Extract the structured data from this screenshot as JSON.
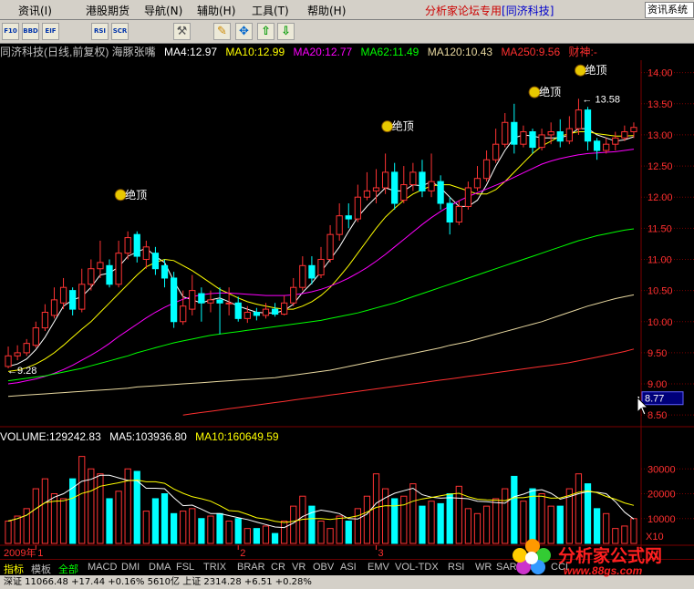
{
  "menu": {
    "items": [
      "资讯(I)",
      "港股期货",
      "导航(N)",
      "辅助(H)",
      "工具(T)",
      "帮助(H)"
    ],
    "brand": "分析家论坛专用",
    "brand_app": "[同济科技]",
    "right_label": "资讯系统"
  },
  "toolbar": {
    "buttons": [
      "F10",
      "BBD",
      "EIF",
      "RSI",
      "SCR",
      "tools-icon",
      "pencil-icon",
      "move-icon",
      "arrow-up-icon",
      "arrow-down-icon"
    ]
  },
  "info": {
    "title": "同济科技(日线,前复权) 海豚张嘴",
    "ma": [
      {
        "label": "MA4:12.97",
        "color": "#ffffff"
      },
      {
        "label": "MA10:12.99",
        "color": "#ffff00"
      },
      {
        "label": "MA20:12.77",
        "color": "#ff00ff"
      },
      {
        "label": "MA62:11.49",
        "color": "#00ff00"
      },
      {
        "label": "MA120:10.43",
        "color": "#e8d8a0"
      },
      {
        "label": "MA250:9.56",
        "color": "#ff3030"
      }
    ],
    "extra": "财神:-"
  },
  "volume_info": {
    "items": [
      {
        "label": "VOLUME:129242.83",
        "color": "#ffffff"
      },
      {
        "label": "MA5:103936.80",
        "color": "#ffffff"
      },
      {
        "label": "MA10:160649.59",
        "color": "#ffff00"
      }
    ]
  },
  "signals": [
    {
      "label": "绝顶",
      "index": 13
    },
    {
      "label": "绝顶",
      "index": 42
    },
    {
      "label": "绝顶",
      "index": 58
    },
    {
      "label": "绝顶",
      "index": 63
    }
  ],
  "annotations": {
    "low_label": "9.28",
    "high_label": "13.58",
    "cursor_price": "8.77"
  },
  "bottom_axis": {
    "year": "2009年",
    "months": [
      {
        "label": "1",
        "index": 3
      },
      {
        "label": "2",
        "index": 25
      },
      {
        "label": "3",
        "index": 40
      }
    ]
  },
  "tabs": {
    "left": [
      "指标",
      "模板",
      "全部"
    ],
    "indicators": [
      "MACD",
      "DMI",
      "DMA",
      "FSL",
      "TRIX",
      "BRAR",
      "CR",
      "VR",
      "OBV",
      "ASI",
      "EMV",
      "VOL-TDX",
      "RSI",
      "WR",
      "SAR",
      "KDJ",
      "CCI"
    ]
  },
  "status": {
    "text": "深证  11066.48  +17.44  +0.16%  5610亿  上证  2314.28  +6.51  +0.28%  "
  },
  "watermark": {
    "title": "分析家公式网",
    "url": "www.88gs.com"
  },
  "colors": {
    "up": "#ff3333",
    "down": "#00ffff",
    "grid": "#7a0000",
    "axis_text": "#ff3030",
    "bg": "#000000"
  },
  "chart_data": {
    "type": "candlestick",
    "price_ylim": [
      8.4,
      14.2
    ],
    "price_ticks": [
      8.5,
      9.0,
      9.5,
      10.0,
      10.5,
      11.0,
      11.5,
      12.0,
      12.5,
      13.0,
      13.5,
      14.0
    ],
    "volume_ticks": [
      10000,
      20000,
      30000
    ],
    "volume_ylim": [
      0,
      40000
    ],
    "volume_unit": "X10",
    "candles": [
      [
        9.28,
        9.45,
        9.6,
        9.25
      ],
      [
        9.45,
        9.5,
        9.62,
        9.38
      ],
      [
        9.5,
        9.65,
        9.72,
        9.45
      ],
      [
        9.62,
        9.9,
        10.0,
        9.58
      ],
      [
        9.9,
        10.15,
        10.28,
        9.85
      ],
      [
        10.1,
        10.35,
        10.55,
        10.05
      ],
      [
        10.3,
        10.55,
        10.7,
        10.2
      ],
      [
        10.5,
        10.2,
        10.55,
        10.1
      ],
      [
        10.2,
        10.6,
        10.85,
        10.15
      ],
      [
        10.6,
        10.85,
        11.0,
        10.5
      ],
      [
        10.85,
        10.95,
        11.3,
        10.7
      ],
      [
        10.9,
        10.6,
        11.0,
        10.55
      ],
      [
        10.6,
        11.1,
        11.3,
        10.55
      ],
      [
        11.1,
        11.35,
        11.45,
        11.0
      ],
      [
        11.4,
        11.05,
        11.45,
        10.95
      ],
      [
        11.0,
        11.2,
        11.3,
        10.85
      ],
      [
        11.1,
        10.85,
        11.2,
        10.75
      ],
      [
        10.9,
        10.7,
        11.0,
        10.55
      ],
      [
        10.7,
        10.0,
        10.8,
        9.9
      ],
      [
        10.0,
        10.25,
        10.5,
        9.95
      ],
      [
        10.2,
        10.5,
        10.75,
        10.1
      ],
      [
        10.45,
        10.3,
        10.55,
        10.0
      ],
      [
        10.3,
        10.35,
        10.5,
        10.15
      ],
      [
        10.35,
        10.3,
        10.55,
        9.8
      ],
      [
        10.3,
        10.3,
        10.55,
        10.1
      ],
      [
        10.3,
        10.05,
        10.4,
        10.0
      ],
      [
        10.05,
        10.15,
        10.25,
        9.98
      ],
      [
        10.15,
        10.1,
        10.22,
        10.02
      ],
      [
        10.1,
        10.2,
        10.3,
        10.05
      ],
      [
        10.2,
        10.12,
        10.3,
        10.08
      ],
      [
        10.12,
        10.3,
        10.42,
        10.1
      ],
      [
        10.3,
        10.55,
        10.7,
        10.25
      ],
      [
        10.55,
        10.9,
        11.05,
        10.5
      ],
      [
        10.9,
        10.7,
        11.05,
        10.6
      ],
      [
        10.75,
        11.0,
        11.2,
        10.7
      ],
      [
        11.0,
        11.4,
        11.55,
        10.95
      ],
      [
        11.4,
        11.7,
        11.9,
        11.3
      ],
      [
        11.7,
        11.65,
        11.9,
        11.5
      ],
      [
        11.65,
        12.0,
        12.2,
        11.6
      ],
      [
        12.0,
        12.1,
        12.4,
        11.95
      ],
      [
        12.1,
        12.15,
        12.45,
        11.9
      ],
      [
        12.15,
        12.4,
        12.7,
        12.05
      ],
      [
        12.4,
        11.9,
        12.55,
        11.8
      ],
      [
        11.95,
        12.2,
        12.5,
        11.9
      ],
      [
        12.2,
        12.4,
        12.55,
        12.1
      ],
      [
        12.4,
        12.1,
        12.6,
        12.0
      ],
      [
        12.1,
        12.25,
        12.7,
        12.0
      ],
      [
        12.25,
        11.9,
        12.35,
        11.8
      ],
      [
        11.9,
        11.6,
        12.0,
        11.4
      ],
      [
        11.6,
        11.85,
        11.95,
        11.55
      ],
      [
        11.85,
        12.15,
        12.25,
        11.8
      ],
      [
        12.15,
        12.3,
        12.5,
        12.1
      ],
      [
        12.3,
        12.6,
        12.75,
        12.25
      ],
      [
        12.6,
        12.85,
        13.1,
        12.55
      ],
      [
        12.85,
        13.2,
        13.35,
        12.8
      ],
      [
        13.2,
        12.85,
        13.5,
        12.7
      ],
      [
        12.85,
        13.05,
        13.15,
        12.8
      ],
      [
        13.05,
        12.8,
        13.1,
        12.7
      ],
      [
        12.8,
        13.0,
        13.1,
        12.75
      ],
      [
        13.0,
        13.05,
        13.2,
        12.85
      ],
      [
        13.05,
        12.9,
        13.25,
        12.8
      ],
      [
        12.9,
        13.1,
        13.3,
        12.85
      ],
      [
        13.1,
        13.4,
        13.58,
        13.0
      ],
      [
        13.4,
        12.9,
        13.45,
        12.75
      ],
      [
        12.9,
        12.75,
        12.95,
        12.6
      ],
      [
        12.75,
        12.85,
        12.95,
        12.7
      ],
      [
        12.85,
        12.95,
        13.05,
        12.75
      ],
      [
        12.95,
        13.05,
        13.15,
        12.9
      ],
      [
        13.05,
        13.12,
        13.2,
        12.95
      ]
    ],
    "volumes": [
      9000,
      11000,
      14000,
      22000,
      26000,
      20000,
      18000,
      26000,
      35000,
      30000,
      28000,
      18000,
      21000,
      30000,
      29000,
      13000,
      18000,
      20000,
      12000,
      13000,
      14000,
      10000,
      11000,
      12000,
      9000,
      10000,
      6000,
      6000,
      7000,
      4000,
      9000,
      15000,
      19000,
      15000,
      9000,
      6000,
      11000,
      9000,
      14000,
      19000,
      28000,
      22000,
      18000,
      19000,
      24000,
      15000,
      17000,
      16000,
      20000,
      23000,
      14000,
      12000,
      15000,
      18000,
      22000,
      27000,
      17000,
      22000,
      20000,
      15000,
      15000,
      22000,
      28000,
      24000,
      14000,
      12000,
      6000,
      7000,
      10000
    ],
    "ma_lines": [
      {
        "name": "MA4",
        "color": "#ffffff",
        "values": [
          9.28,
          9.32,
          9.4,
          9.55,
          9.75,
          10.0,
          10.25,
          10.35,
          10.4,
          10.55,
          10.75,
          10.78,
          10.88,
          11.05,
          11.12,
          11.18,
          11.05,
          10.95,
          10.65,
          10.4,
          10.35,
          10.3,
          10.35,
          10.38,
          10.32,
          10.25,
          10.2,
          10.15,
          10.14,
          10.14,
          10.18,
          10.28,
          10.47,
          10.62,
          10.8,
          11.0,
          11.2,
          11.45,
          11.68,
          11.85,
          12.0,
          12.15,
          12.1,
          12.1,
          12.2,
          12.18,
          12.25,
          12.15,
          12.0,
          11.85,
          11.85,
          11.95,
          12.2,
          12.5,
          12.75,
          12.95,
          13.0,
          12.98,
          12.95,
          12.95,
          12.95,
          13.0,
          13.1,
          13.1,
          13.0,
          12.95,
          12.9,
          12.92,
          12.97
        ]
      },
      {
        "name": "MA10",
        "color": "#ffff00",
        "values": [
          9.2,
          9.22,
          9.26,
          9.32,
          9.4,
          9.5,
          9.62,
          9.75,
          9.88,
          10.0,
          10.15,
          10.3,
          10.45,
          10.6,
          10.75,
          10.88,
          10.95,
          11.0,
          10.98,
          10.9,
          10.82,
          10.72,
          10.62,
          10.52,
          10.45,
          10.38,
          10.32,
          10.28,
          10.25,
          10.22,
          10.2,
          10.2,
          10.25,
          10.32,
          10.42,
          10.55,
          10.72,
          10.9,
          11.1,
          11.3,
          11.5,
          11.68,
          11.82,
          11.95,
          12.05,
          12.12,
          12.18,
          12.2,
          12.2,
          12.15,
          12.1,
          12.05,
          12.05,
          12.12,
          12.25,
          12.4,
          12.55,
          12.7,
          12.82,
          12.9,
          12.98,
          13.02,
          13.05,
          13.05,
          13.02,
          13.0,
          12.98,
          12.98,
          12.99
        ]
      },
      {
        "name": "MA20",
        "color": "#ff00ff",
        "values": [
          9.0,
          9.02,
          9.05,
          9.08,
          9.12,
          9.17,
          9.23,
          9.3,
          9.38,
          9.46,
          9.55,
          9.65,
          9.76,
          9.86,
          9.96,
          10.06,
          10.15,
          10.23,
          10.3,
          10.36,
          10.4,
          10.43,
          10.45,
          10.46,
          10.46,
          10.45,
          10.44,
          10.43,
          10.42,
          10.42,
          10.42,
          10.43,
          10.45,
          10.48,
          10.52,
          10.57,
          10.63,
          10.7,
          10.78,
          10.87,
          10.97,
          11.08,
          11.2,
          11.32,
          11.44,
          11.56,
          11.67,
          11.77,
          11.86,
          11.94,
          12.01,
          12.07,
          12.13,
          12.19,
          12.25,
          12.32,
          12.39,
          12.46,
          12.53,
          12.58,
          12.62,
          12.65,
          12.68,
          12.7,
          12.71,
          12.72,
          12.73,
          12.75,
          12.77
        ]
      },
      {
        "name": "MA62",
        "color": "#00ff00",
        "values": [
          9.05,
          9.07,
          9.09,
          9.11,
          9.13,
          9.16,
          9.19,
          9.22,
          9.25,
          9.29,
          9.33,
          9.37,
          9.41,
          9.45,
          9.5,
          9.54,
          9.58,
          9.62,
          9.66,
          9.69,
          9.72,
          9.75,
          9.78,
          9.8,
          9.82,
          9.84,
          9.86,
          9.88,
          9.9,
          9.92,
          9.94,
          9.96,
          9.98,
          10.0,
          10.02,
          10.05,
          10.08,
          10.11,
          10.14,
          10.18,
          10.22,
          10.26,
          10.3,
          10.35,
          10.4,
          10.45,
          10.5,
          10.55,
          10.6,
          10.65,
          10.7,
          10.75,
          10.8,
          10.85,
          10.9,
          10.95,
          11.0,
          11.05,
          11.1,
          11.15,
          11.2,
          11.25,
          11.3,
          11.34,
          11.38,
          11.41,
          11.44,
          11.47,
          11.49
        ]
      },
      {
        "name": "MA120",
        "color": "#e8d8a0",
        "values": [
          8.8,
          8.81,
          8.82,
          8.83,
          8.84,
          8.85,
          8.86,
          8.87,
          8.88,
          8.89,
          8.9,
          8.91,
          8.92,
          8.93,
          8.95,
          8.96,
          8.97,
          8.98,
          8.99,
          9.0,
          9.01,
          9.02,
          9.03,
          9.04,
          9.05,
          9.06,
          9.07,
          9.08,
          9.09,
          9.1,
          9.12,
          9.14,
          9.16,
          9.18,
          9.2,
          9.22,
          9.25,
          9.28,
          9.31,
          9.34,
          9.37,
          9.4,
          9.43,
          9.46,
          9.49,
          9.52,
          9.55,
          9.58,
          9.62,
          9.65,
          9.68,
          9.72,
          9.76,
          9.8,
          9.84,
          9.88,
          9.92,
          9.96,
          10.0,
          10.05,
          10.1,
          10.15,
          10.2,
          10.25,
          10.29,
          10.33,
          10.37,
          10.4,
          10.43
        ]
      },
      {
        "name": "MA250",
        "color": "#ff3030",
        "values": [
          null,
          null,
          null,
          null,
          null,
          null,
          null,
          null,
          null,
          null,
          null,
          null,
          null,
          null,
          null,
          null,
          null,
          null,
          null,
          8.5,
          8.52,
          8.54,
          8.56,
          8.58,
          8.6,
          8.62,
          8.64,
          8.66,
          8.68,
          8.7,
          8.72,
          8.74,
          8.76,
          8.78,
          8.8,
          8.82,
          8.84,
          8.86,
          8.88,
          8.9,
          8.92,
          8.94,
          8.96,
          8.98,
          9.0,
          9.02,
          9.04,
          9.06,
          9.08,
          9.1,
          9.12,
          9.14,
          9.16,
          9.18,
          9.2,
          9.22,
          9.24,
          9.26,
          9.28,
          9.3,
          9.32,
          9.34,
          9.37,
          9.4,
          9.43,
          9.46,
          9.49,
          9.52,
          9.56
        ]
      }
    ]
  }
}
